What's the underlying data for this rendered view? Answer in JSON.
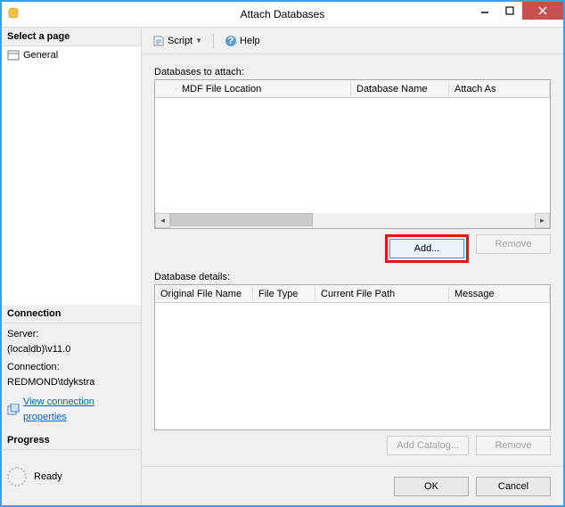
{
  "titlebar": {
    "title": "Attach Databases"
  },
  "left": {
    "select_page_hdr": "Select a page",
    "general_item": "General",
    "connection_hdr": "Connection",
    "server_label": "Server:",
    "server_value": "(localdb)\\v11.0",
    "conn_label": "Connection:",
    "conn_value": "REDMOND\\tdykstra",
    "view_conn_link": "View connection properties",
    "progress_hdr": "Progress",
    "progress_status": "Ready"
  },
  "toolbar": {
    "script_label": "Script",
    "help_label": "Help"
  },
  "main": {
    "attach_label": "Databases to attach:",
    "attach_cols": {
      "c0": "",
      "c1": "MDF File Location",
      "c2": "Database Name",
      "c3": "Attach As"
    },
    "add_btn": "Add...",
    "remove_btn": "Remove",
    "details_label": "Database details:",
    "details_cols": {
      "c0": "Original File Name",
      "c1": "File Type",
      "c2": "Current File Path",
      "c3": "Message"
    },
    "add_catalog_btn": "Add Catalog...",
    "remove2_btn": "Remove"
  },
  "footer": {
    "ok": "OK",
    "cancel": "Cancel"
  }
}
